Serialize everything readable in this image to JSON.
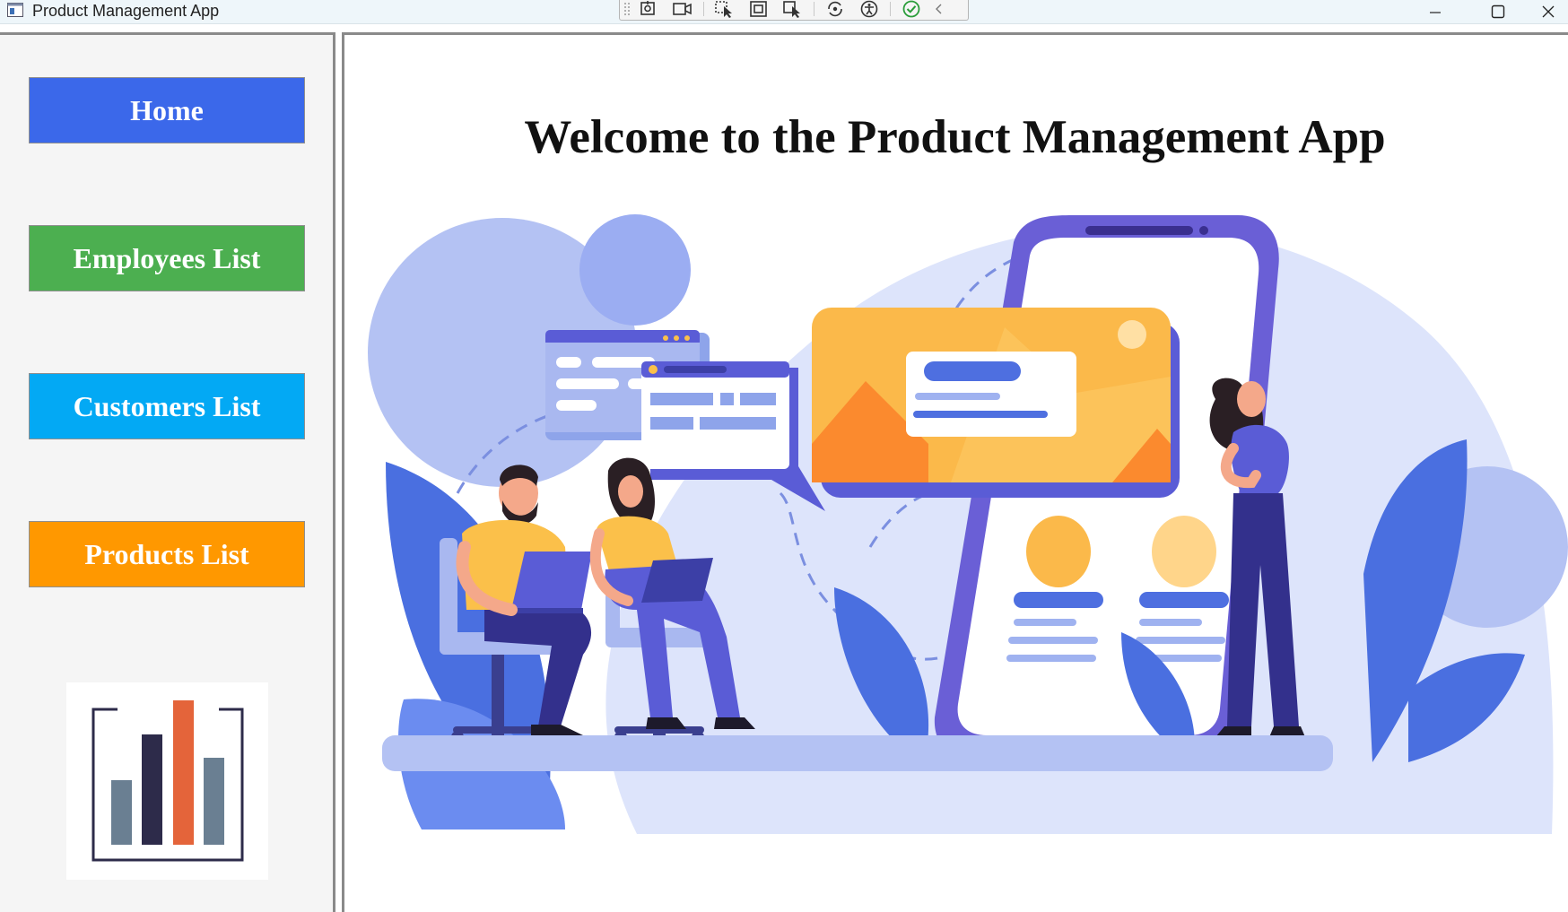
{
  "window": {
    "title": "Product Management App",
    "controls": [
      "minimize-icon",
      "maximize-icon",
      "close-icon"
    ]
  },
  "debug_toolbar": {
    "icons": [
      "grip-icon",
      "select-element-icon",
      "record-icon",
      "pointer-select-icon",
      "layout-adorner-icon",
      "track-focus-icon",
      "hot-reload-icon",
      "accessibility-icon",
      "binding-check-icon",
      "collapse-icon"
    ]
  },
  "sidebar": {
    "buttons": [
      {
        "label": "Home",
        "color": "#3b68ea"
      },
      {
        "label": "Employees List",
        "color": "#4caf50"
      },
      {
        "label": "Customers List",
        "color": "#03a9f4"
      },
      {
        "label": "Products List",
        "color": "#ff9800"
      }
    ],
    "logo": "bar-chart-logo"
  },
  "main": {
    "heading": "Welcome to the Product Management App",
    "illustration": "team-working-on-mobile-app-illustration"
  }
}
